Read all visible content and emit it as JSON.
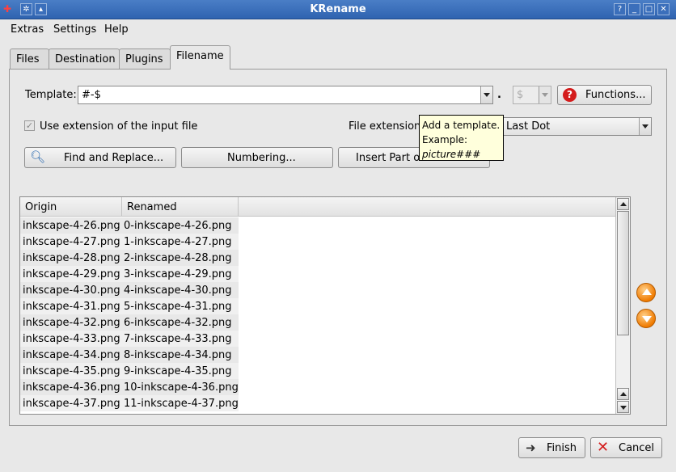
{
  "window": {
    "title": "KRename"
  },
  "menu": {
    "items": [
      "Extras",
      "Settings",
      "Help"
    ]
  },
  "tabs": [
    "Files",
    "Destination",
    "Plugins",
    "Filename"
  ],
  "filename": {
    "template_label": "Template:",
    "template_value": "#-$",
    "dot": ".",
    "ext_template": "$",
    "functions_label": "Functions...",
    "use_extension_label": "Use extension of the input file",
    "file_extension_starts_label": "File extension s",
    "file_extension_value": "Last Dot",
    "find_replace_label": "Find and Replace...",
    "numbering_label": "Numbering...",
    "insert_part_label": "Insert Part of"
  },
  "tooltip": {
    "line1": "Add a template.",
    "line2": "Example:",
    "line3": "picture###"
  },
  "list": {
    "columns": [
      "Origin",
      "Renamed"
    ],
    "rows": [
      [
        "inkscape-4-26.png",
        "0-inkscape-4-26.png"
      ],
      [
        "inkscape-4-27.png",
        "1-inkscape-4-27.png"
      ],
      [
        "inkscape-4-28.png",
        "2-inkscape-4-28.png"
      ],
      [
        "inkscape-4-29.png",
        "3-inkscape-4-29.png"
      ],
      [
        "inkscape-4-30.png",
        "4-inkscape-4-30.png"
      ],
      [
        "inkscape-4-31.png",
        "5-inkscape-4-31.png"
      ],
      [
        "inkscape-4-32.png",
        "6-inkscape-4-32.png"
      ],
      [
        "inkscape-4-33.png",
        "7-inkscape-4-33.png"
      ],
      [
        "inkscape-4-34.png",
        "8-inkscape-4-34.png"
      ],
      [
        "inkscape-4-35.png",
        "9-inkscape-4-35.png"
      ],
      [
        "inkscape-4-36.png",
        "10-inkscape-4-36.png"
      ],
      [
        "inkscape-4-37.png",
        "11-inkscape-4-37.png"
      ]
    ]
  },
  "footer": {
    "finish_label": "Finish",
    "cancel_label": "Cancel"
  },
  "colors": {
    "titlebar": "#2f63b0",
    "tooltip_bg": "#ffffdc",
    "accent_orange": "#f07b00",
    "help_red": "#d41c1c"
  }
}
